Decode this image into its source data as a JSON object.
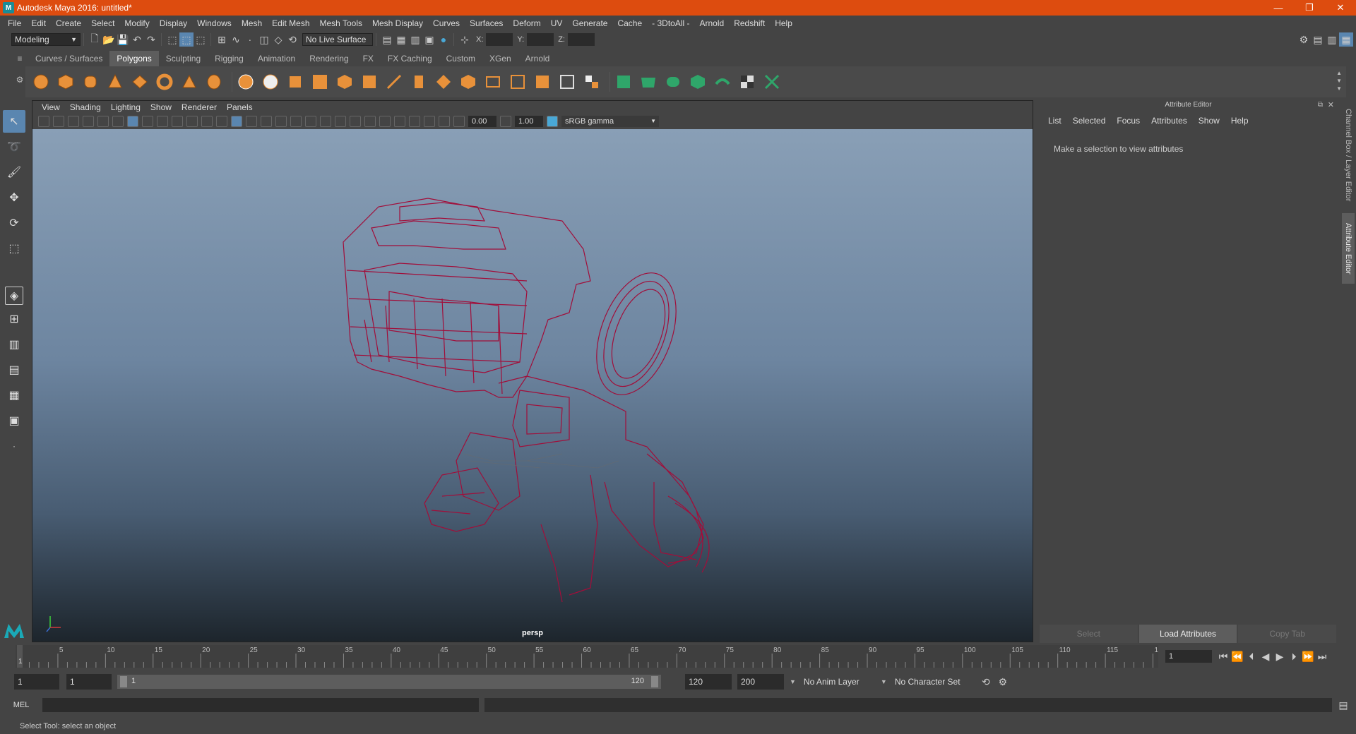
{
  "title": "Autodesk Maya 2016: untitled*",
  "menu": [
    "File",
    "Edit",
    "Create",
    "Select",
    "Modify",
    "Display",
    "Windows",
    "Mesh",
    "Edit Mesh",
    "Mesh Tools",
    "Mesh Display",
    "Curves",
    "Surfaces",
    "Deform",
    "UV",
    "Generate",
    "Cache",
    "- 3DtoAll -",
    "Arnold",
    "Redshift",
    "Help"
  ],
  "status": {
    "mode": "Modeling",
    "live_surface": "No Live Surface",
    "x_label": "X:",
    "y_label": "Y:",
    "z_label": "Z:"
  },
  "shelf_tabs": [
    "Curves / Surfaces",
    "Polygons",
    "Sculpting",
    "Rigging",
    "Animation",
    "Rendering",
    "FX",
    "FX Caching",
    "Custom",
    "XGen",
    "Arnold"
  ],
  "shelf_active": "Polygons",
  "viewport": {
    "menu": [
      "View",
      "Shading",
      "Lighting",
      "Show",
      "Renderer",
      "Panels"
    ],
    "exposure": "0.00",
    "gamma": "1.00",
    "color_space": "sRGB gamma",
    "camera_label": "persp",
    "wire_color": "#a10e3a"
  },
  "attribute_editor": {
    "header": "Attribute Editor",
    "menu": [
      "List",
      "Selected",
      "Focus",
      "Attributes",
      "Show",
      "Help"
    ],
    "message": "Make a selection to view attributes",
    "buttons": [
      "Select",
      "Load Attributes",
      "Copy Tab"
    ],
    "active_button": "Load Attributes"
  },
  "side_tabs": [
    "Channel Box / Layer Editor",
    "Attribute Editor"
  ],
  "timeline": {
    "ticks": [
      "5",
      "10",
      "15",
      "20",
      "25",
      "30",
      "35",
      "40",
      "45",
      "50",
      "55",
      "60",
      "65",
      "70",
      "75",
      "80",
      "85",
      "90",
      "95",
      "100",
      "105",
      "110",
      "115",
      "120"
    ],
    "start_label": "1",
    "current_frame": "1"
  },
  "range": {
    "start": "1",
    "playback_start": "1",
    "slider_start": "1",
    "slider_end": "120",
    "playback_end": "120",
    "end": "200",
    "anim_layer": "No Anim Layer",
    "character_set": "No Character Set"
  },
  "command": {
    "label": "MEL"
  },
  "help_line": "Select Tool: select an object"
}
